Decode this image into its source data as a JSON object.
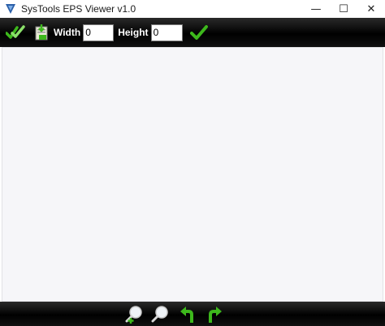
{
  "window": {
    "title": "SysTools EPS Viewer v1.0",
    "controls": {
      "minimize": "—",
      "maximize": "☐",
      "close": "✕"
    }
  },
  "toolbar": {
    "width_label": "Width",
    "width_value": "0",
    "height_label": "Height",
    "height_value": "0"
  },
  "icons": {
    "check_all": "double-check-icon",
    "save": "save-document-icon",
    "apply": "check-icon",
    "zoom_in": "zoom-in-icon",
    "zoom_out": "zoom-out-icon",
    "rotate_left": "rotate-left-icon",
    "rotate_right": "rotate-right-icon"
  },
  "colors": {
    "toolbar_bg": "#000000",
    "accent_green": "#3db81c",
    "canvas_bg": "#f6f6f9"
  }
}
